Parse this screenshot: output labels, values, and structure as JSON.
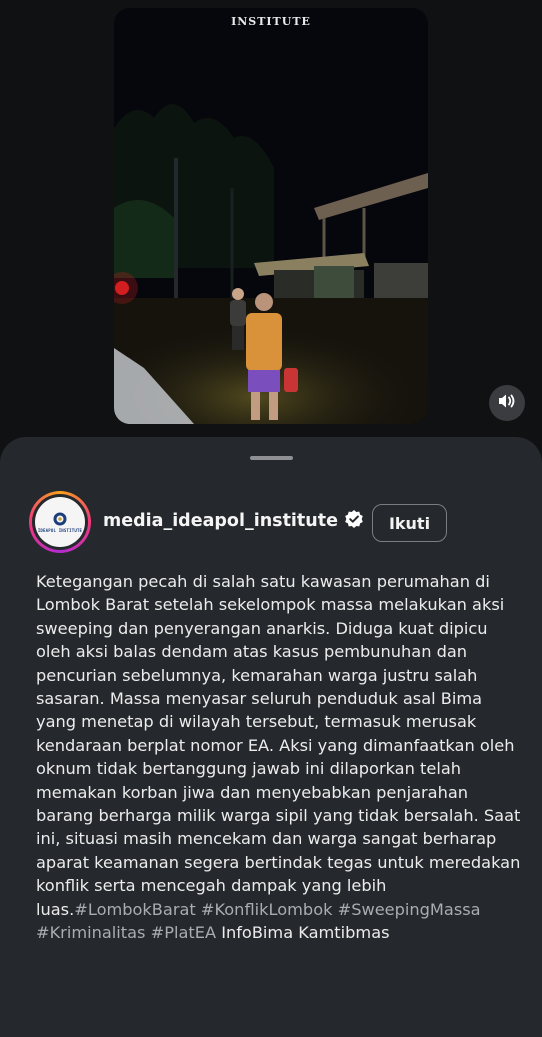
{
  "video": {
    "watermark": "INSTITUTE",
    "sound_icon": "speaker-icon"
  },
  "post": {
    "username": "media_ideapol_institute",
    "verified_icon": "verified-badge-icon",
    "avatar_text": "IDEAPOL INSTITUTE",
    "follow_label": "Ikuti",
    "caption_text": "Ketegangan pecah di salah satu kawasan perumahan di Lombok Barat setelah sekelompok massa melakukan aksi sweeping dan penyerangan anarkis. Diduga kuat dipicu oleh aksi balas dendam atas kasus pembunuhan dan pencurian sebelumnya, kemarahan warga justru salah sasaran. Massa menyasar seluruh penduduk asal Bima yang menetap di wilayah tersebut, termasuk merusak kendaraan berplat nomor EA. Aksi yang dimanfaatkan oleh oknum tidak bertanggung jawab ini dilaporkan telah memakan korban jiwa dan menyebabkan penjarahan barang berharga milik warga sipil yang tidak bersalah. Saat ini, situasi masih mencekam dan warga sangat berharap aparat keamanan segera bertindak tegas untuk meredakan konflik serta mencegah dampak yang lebih luas.",
    "hashtags": [
      "#LombokBarat",
      "#KonflikLombok",
      "#SweepingMassa",
      "#Kriminalitas",
      "#PlatEA"
    ],
    "plain_tags": [
      "InfoBima",
      "Kamtibmas"
    ]
  },
  "colors": {
    "sheet_bg": "#25282c",
    "hashtag": "#a9adb3",
    "text": "#ececec"
  }
}
